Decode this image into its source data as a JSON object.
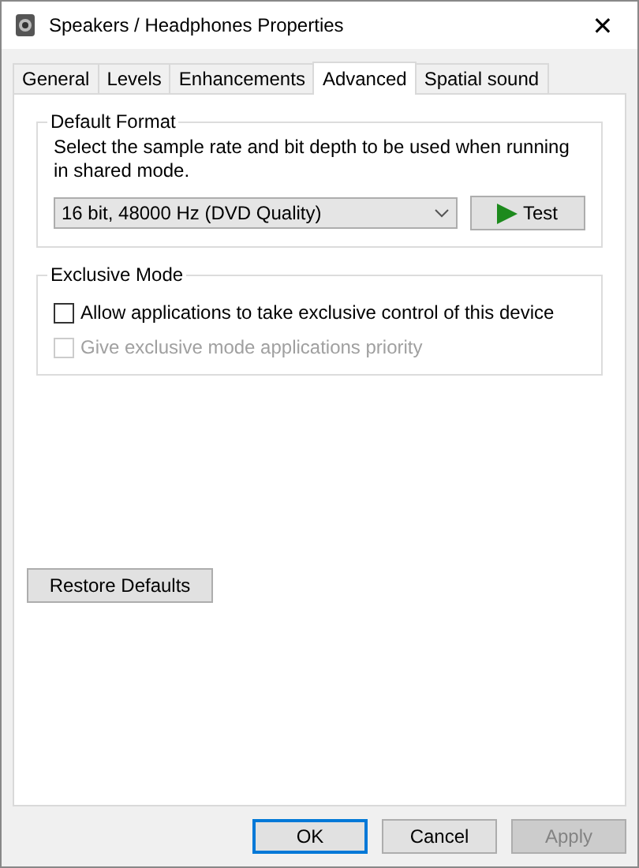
{
  "window": {
    "title": "Speakers / Headphones Properties",
    "close": "✕"
  },
  "tabs": [
    {
      "label": "General",
      "selected": false
    },
    {
      "label": "Levels",
      "selected": false
    },
    {
      "label": "Enhancements",
      "selected": false
    },
    {
      "label": "Advanced",
      "selected": true
    },
    {
      "label": "Spatial sound",
      "selected": false
    }
  ],
  "default_format": {
    "legend": "Default Format",
    "description": "Select the sample rate and bit depth to be used when running in shared mode.",
    "format": "16 bit, 48000 Hz (DVD Quality)",
    "test_button": "Test"
  },
  "exclusive_mode": {
    "legend": "Exclusive Mode",
    "options": [
      {
        "label": "Allow applications to take exclusive control of this device",
        "checked": false,
        "disabled": false
      },
      {
        "label": "Give exclusive mode applications priority",
        "checked": false,
        "disabled": true
      }
    ]
  },
  "restore_button": "Restore Defaults",
  "buttons": [
    {
      "label": "OK",
      "kind": "default",
      "disabled": false
    },
    {
      "label": "Cancel",
      "kind": "normal",
      "disabled": false
    },
    {
      "label": "Apply",
      "kind": "normal",
      "disabled": true
    }
  ]
}
